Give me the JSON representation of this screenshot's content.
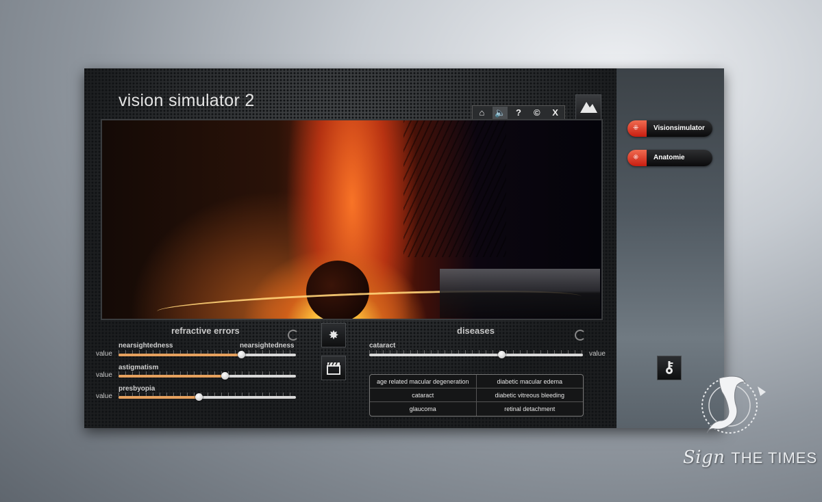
{
  "app": {
    "title": "vision simulator 2"
  },
  "toolbar": {
    "items": [
      {
        "icon": "home-icon",
        "glyph": "⌂"
      },
      {
        "icon": "sound-icon",
        "glyph": "🔈"
      },
      {
        "icon": "help-icon",
        "glyph": "?"
      },
      {
        "icon": "copyright-icon",
        "glyph": "©"
      },
      {
        "icon": "close-icon",
        "glyph": "X"
      }
    ]
  },
  "refractive_errors": {
    "title": "refractive errors",
    "value_label": "value",
    "sliders": [
      {
        "label_left": "nearsightedness",
        "label_right": "nearsightedness",
        "level": 0.69
      },
      {
        "label_left": "astigmatism",
        "level": 0.6
      },
      {
        "label_left": "presbyopia",
        "level": 0.45
      }
    ]
  },
  "diseases": {
    "title": "diseases",
    "value_label": "value",
    "slider": {
      "label": "cataract",
      "level": 0.62
    },
    "list": [
      "age related macular degeneration",
      "diabetic macular edema",
      "cataract",
      "diabetic vitreous bleeding",
      "glaucoma",
      "retinal detachment"
    ]
  },
  "nav": {
    "items": [
      "Visionsimulator",
      "Anatomie"
    ]
  },
  "logo": {
    "text_sign": "Sign",
    "text_rest": "THE TIMES"
  },
  "colors": {
    "accent": "#e6a15e",
    "nav_cap": "#d8321d"
  }
}
